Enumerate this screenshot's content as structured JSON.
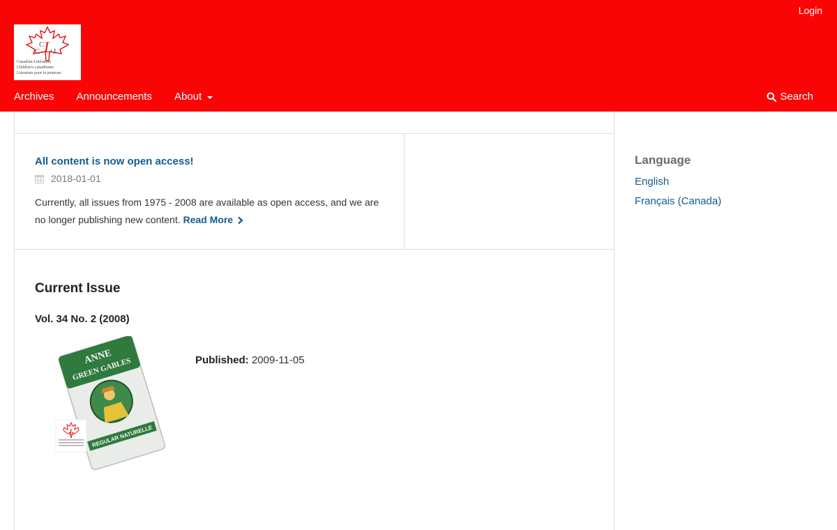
{
  "header": {
    "login_label": "Login",
    "logo_text_lines": [
      "Canadian Littérature",
      "Children's canadienne",
      "Literature pour la jeunesse"
    ],
    "logo_letters": "CCLJ",
    "nav": {
      "archives": "Archives",
      "announcements": "Announcements",
      "about": "About",
      "search": "Search"
    },
    "background_color": "#fa0505"
  },
  "announcement": {
    "title": "All content is now open access!",
    "date": "2018-01-01",
    "body": "Currently, all issues from 1975 - 2008 are available as open access, and we are no longer publishing new content.",
    "read_more": "Read More"
  },
  "current_issue": {
    "heading": "Current Issue",
    "issue_title": "Vol. 34 No. 2 (2008)",
    "published_label": "Published:",
    "published_date": "2009-11-05",
    "cover_text": [
      "ANNE",
      "GREEN GABLES",
      "REGULAR NATURELLE"
    ]
  },
  "sidebar": {
    "title": "Language",
    "languages": [
      "English",
      "Français (Canada)"
    ]
  },
  "colors": {
    "accent_red": "#fa0505",
    "link_blue": "#125b8f"
  }
}
